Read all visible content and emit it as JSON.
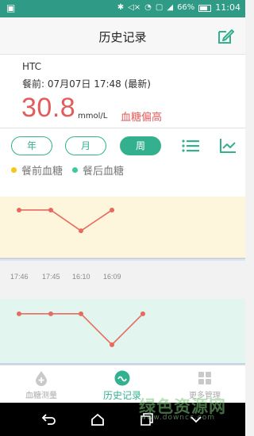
{
  "statusbar": {
    "left_icon": "image-icon",
    "battery_pct": "66%",
    "time": "11:04"
  },
  "header": {
    "title": "历史记录",
    "edit_icon": "edit-icon"
  },
  "reading": {
    "device": "HTC",
    "meal_time": "餐前: 07月07日 17:48 (最新)",
    "value": "30.8",
    "unit": "mmol/L",
    "status": "血糖偏高"
  },
  "period_tabs": {
    "year": "年",
    "month": "月",
    "week": "周",
    "selected": "week"
  },
  "legend": {
    "before": {
      "label": "餐前血糖",
      "color": "#f5c518"
    },
    "after": {
      "label": "餐后血糖",
      "color": "#3ccaa0"
    }
  },
  "colors": {
    "accent": "#33b18f",
    "alert": "#e35b5b",
    "line": "#e86a5e"
  },
  "chart_data": [
    {
      "type": "line",
      "name": "餐前血糖",
      "x": [
        "17:46",
        "17:45",
        "16:10",
        "16:09"
      ],
      "values": [
        30.8,
        30.8,
        15.0,
        30.8
      ],
      "ylim": [
        0,
        35
      ],
      "background": "#fdf6dc"
    },
    {
      "type": "line",
      "name": "餐后血糖",
      "x": [
        "17:46",
        "17:45",
        "16:10",
        "16:09",
        ""
      ],
      "values": [
        30.0,
        30.0,
        30.0,
        8.0,
        30.0
      ],
      "ylim": [
        0,
        35
      ],
      "background": "#e2f6ef"
    }
  ],
  "time_labels": [
    "17:46",
    "17:45",
    "16:10",
    "16:09"
  ],
  "tabbar": {
    "measure": "血糖测量",
    "history": "历史记录",
    "more": "更多管理"
  },
  "watermark": {
    "text": "绿色资源网",
    "sub": "www.downcc.com"
  }
}
